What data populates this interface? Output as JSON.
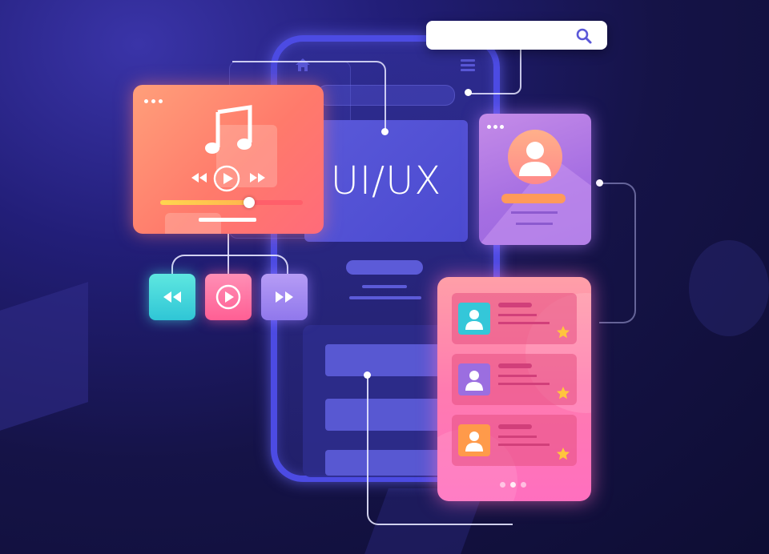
{
  "hero": {
    "title": "UI/UX"
  },
  "icons": {
    "search": "search-icon",
    "home": "home-icon",
    "menu": "menu-icon",
    "music": "music-note-icon",
    "play": "play-icon",
    "rewind": "rewind-icon",
    "forward": "fast-forward-icon",
    "user": "user-icon",
    "star": "star-icon"
  },
  "colors": {
    "background": "#151347",
    "phone_frame": "#4c4be3",
    "music_card": "#ff7a6b",
    "profile_card": "#a56ee2",
    "list_card": "#ff7bb0",
    "rewind_button": "#2fd3d6",
    "play_button": "#ff6f9f",
    "forward_button": "#a88cf0",
    "star": "#ffc53d"
  },
  "music_player": {
    "progress": 0.55
  },
  "list_items": [
    {
      "avatar_color": "#34c7d9"
    },
    {
      "avatar_color": "#9b6ee0"
    },
    {
      "avatar_color": "#ff9a4a"
    }
  ]
}
